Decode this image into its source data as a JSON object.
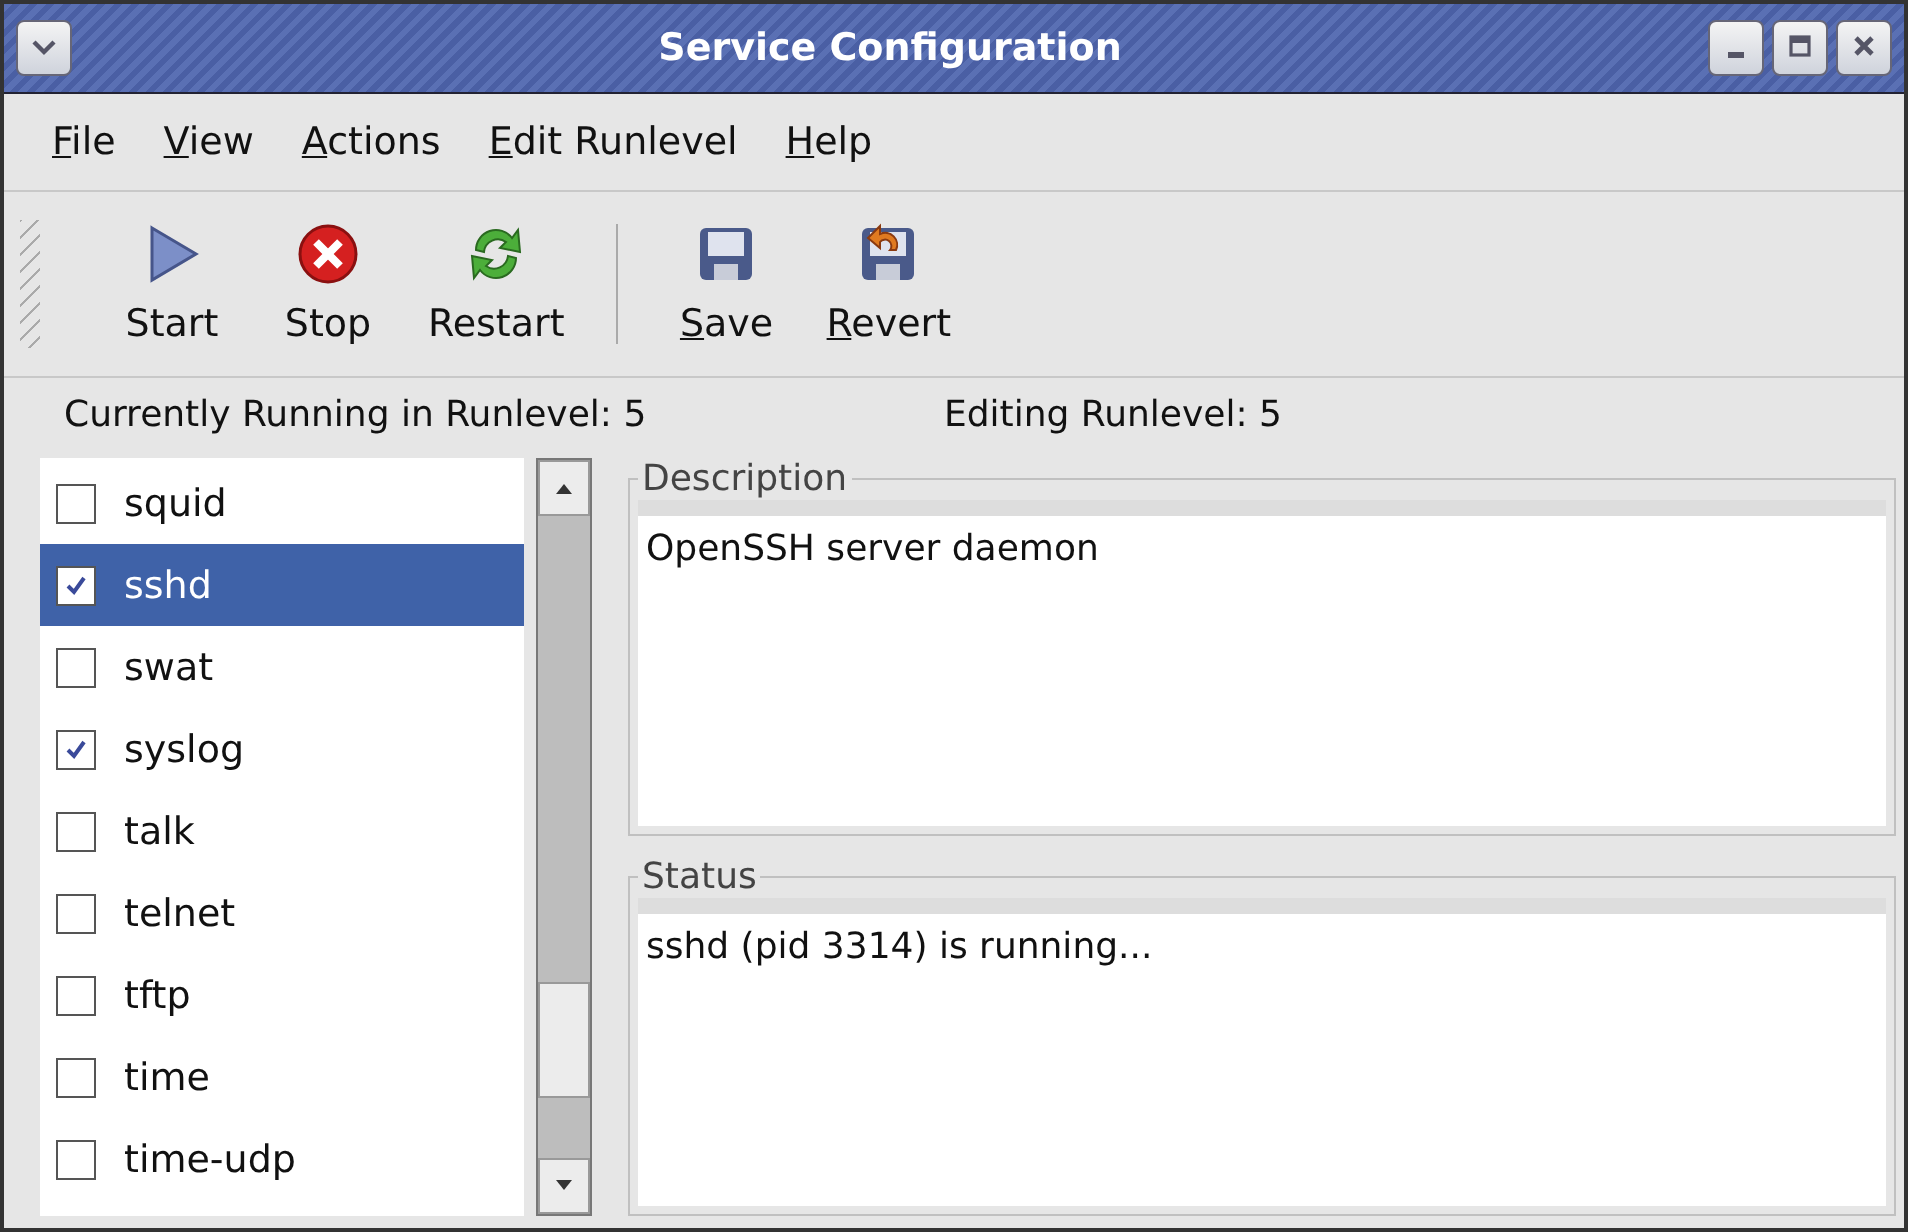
{
  "window": {
    "title": "Service Configuration"
  },
  "menu": [
    {
      "label": "File",
      "underlined_first": true
    },
    {
      "label": "View",
      "underlined_first": true
    },
    {
      "label": "Actions",
      "underlined_first": true
    },
    {
      "label": "Edit Runlevel",
      "underlined_first": true
    },
    {
      "label": "Help",
      "underlined_first": true
    }
  ],
  "toolbar": [
    {
      "kind": "start",
      "label": "Start",
      "underlined_first": false
    },
    {
      "kind": "stop",
      "label": "Stop",
      "underlined_first": false
    },
    {
      "kind": "restart",
      "label": "Restart",
      "underlined_first": false
    },
    {
      "kind": "separator"
    },
    {
      "kind": "save",
      "label": "Save",
      "underlined_first": true
    },
    {
      "kind": "revert",
      "label": "Revert",
      "underlined_first": true
    }
  ],
  "runlevel": {
    "current": "Currently Running in Runlevel: 5",
    "editing": "Editing Runlevel: 5"
  },
  "services": [
    {
      "name": "squid",
      "checked": false,
      "selected": false
    },
    {
      "name": "sshd",
      "checked": true,
      "selected": true
    },
    {
      "name": "swat",
      "checked": false,
      "selected": false
    },
    {
      "name": "syslog",
      "checked": true,
      "selected": false
    },
    {
      "name": "talk",
      "checked": false,
      "selected": false
    },
    {
      "name": "telnet",
      "checked": false,
      "selected": false
    },
    {
      "name": "tftp",
      "checked": false,
      "selected": false
    },
    {
      "name": "time",
      "checked": false,
      "selected": false
    },
    {
      "name": "time-udp",
      "checked": false,
      "selected": false
    }
  ],
  "description": {
    "label": "Description",
    "text": "OpenSSH server daemon"
  },
  "status": {
    "label": "Status",
    "text": "sshd (pid 3314) is running..."
  }
}
